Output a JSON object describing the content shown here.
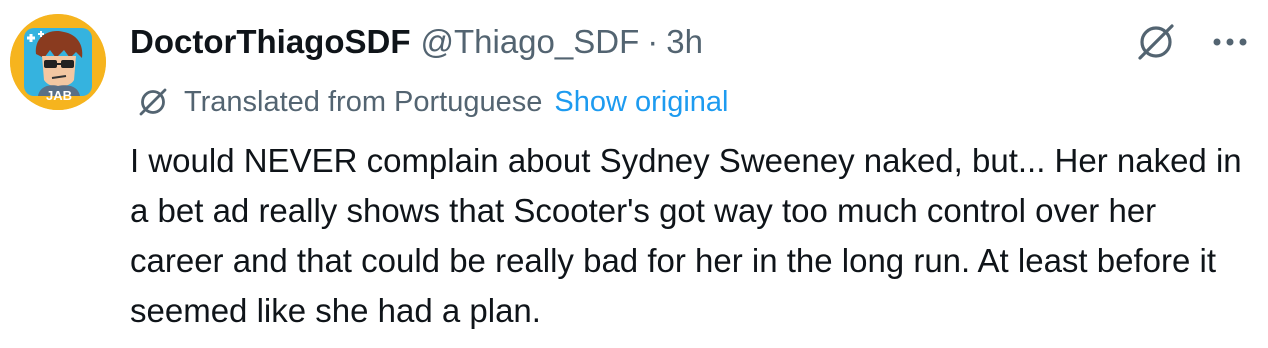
{
  "tweet": {
    "display_name": "DoctorThiagoSDF",
    "handle": "@Thiago_SDF",
    "separator": "·",
    "time": "3h",
    "translation_label": "Translated from Portuguese",
    "show_original": "Show original",
    "text": "I would NEVER complain about Sydney Sweeney naked, but... Her naked in a bet ad really shows that Scooter's got way too much control over her career and that could be really bad for her in the long run. At least before it seemed like she had a plan."
  },
  "avatar": {
    "label": "JAB"
  },
  "icons": {
    "header_translate": "translate-globe-slash-icon",
    "more": "more-horizontal-icon",
    "inline_translate": "translate-globe-slash-icon"
  },
  "colors": {
    "text_primary": "#0f1419",
    "text_secondary": "#536471",
    "link": "#1d9bf0",
    "avatar_background": "#f6b41e"
  }
}
